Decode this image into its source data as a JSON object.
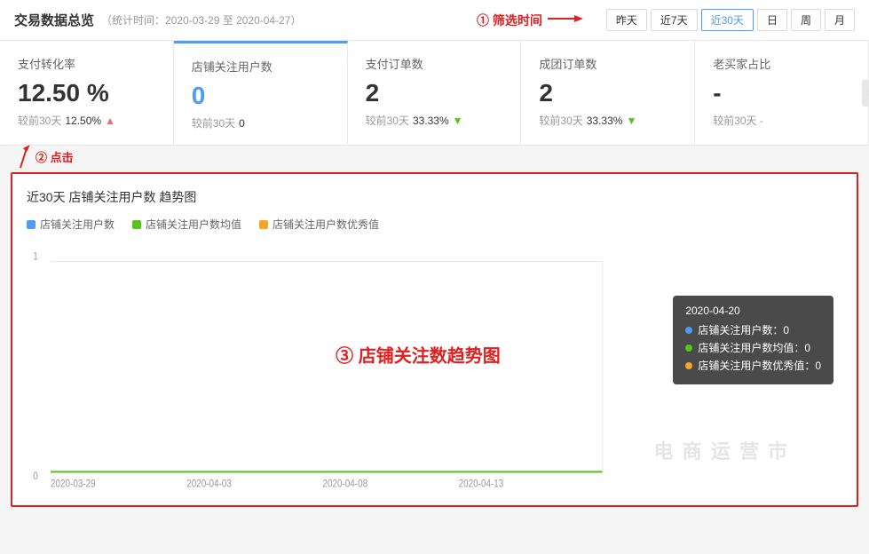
{
  "header": {
    "title": "交易数据总览",
    "subtitle": "（统计时间：2020-03-29 至 2020-04-27）"
  },
  "annotation1": {
    "label": "① 筛选时间"
  },
  "annotation2": {
    "label": "② 点击"
  },
  "annotation3": {
    "label": "③ 店铺关注数趋势图"
  },
  "timeFilter": {
    "buttons": [
      "昨天",
      "近7天",
      "近30天",
      "日",
      "周",
      "月"
    ],
    "active": "近30天"
  },
  "metrics": [
    {
      "label": "支付转化率",
      "value": "12.50 %",
      "compare_label": "较前30天",
      "compare_value": "12.50%",
      "trend": "up"
    },
    {
      "label": "店铺关注用户数",
      "value": "0",
      "compare_label": "较前30天",
      "compare_value": "0",
      "trend": "none",
      "active": true
    },
    {
      "label": "支付订单数",
      "value": "2",
      "compare_label": "较前30天",
      "compare_value": "33.33%",
      "trend": "down"
    },
    {
      "label": "成团订单数",
      "value": "2",
      "compare_label": "较前30天",
      "compare_value": "33.33%",
      "trend": "down"
    },
    {
      "label": "老买家占比",
      "value": "-",
      "compare_label": "较前30天",
      "compare_value": "-",
      "trend": "none"
    }
  ],
  "chart": {
    "title": "近30天 店铺关注用户数 趋势图",
    "legend": [
      {
        "label": "店铺关注用户数",
        "color": "blue"
      },
      {
        "label": "店铺关注用户数均值",
        "color": "green"
      },
      {
        "label": "店铺关注用户数优秀值",
        "color": "yellow"
      }
    ],
    "yAxis": {
      "max": 1,
      "min": 0
    },
    "xAxis": {
      "labels": [
        "2020-03-29",
        "2020-04-03",
        "2020-04-08",
        "2020-04-13"
      ]
    },
    "tooltip": {
      "date": "2020-04-20",
      "rows": [
        {
          "label": "店铺关注用户数：",
          "value": "0",
          "color": "blue"
        },
        {
          "label": "店铺关注用户数均值：",
          "value": "0",
          "color": "green"
        },
        {
          "label": "店铺关注用户数优秀值：",
          "value": "0",
          "color": "yellow"
        }
      ]
    }
  }
}
